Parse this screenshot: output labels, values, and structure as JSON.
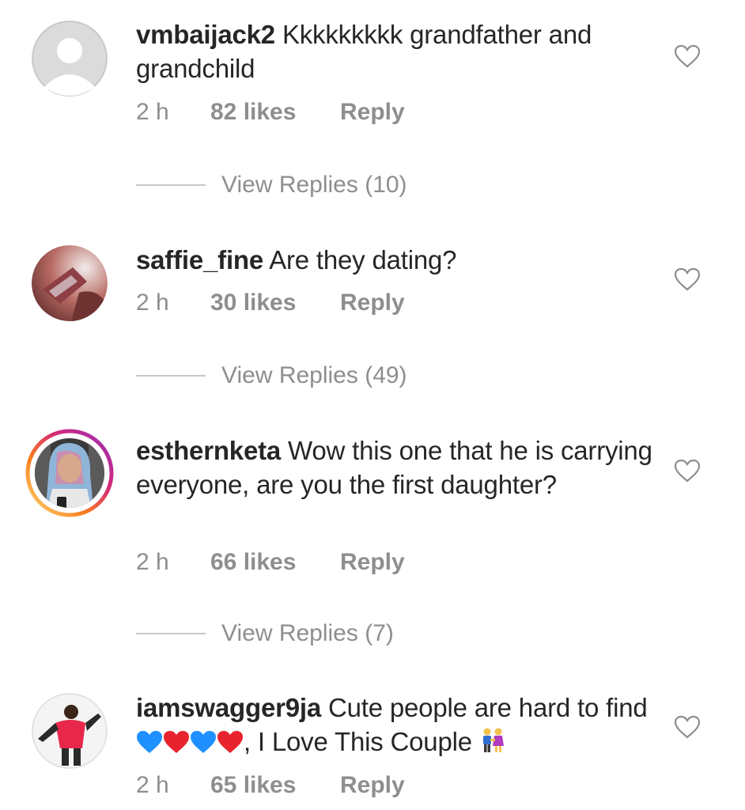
{
  "comments": [
    {
      "username": "vmbaijack2",
      "text": "Kkkkkkkkk grandfather  and grandchild",
      "time": "2 h",
      "likes": "82 likes",
      "reply": "Reply",
      "avatar": "default-avatar-icon",
      "replies_label": "View Replies (10)"
    },
    {
      "username": "saffie_fine",
      "text": "Are they dating?",
      "time": "2 h",
      "likes": "30 likes",
      "reply": "Reply",
      "avatar": "profile-photo",
      "replies_label": "View Replies (49)"
    },
    {
      "username": "esthernketa",
      "text": "Wow this one that he is carrying everyone, are you the first daughter?",
      "time": "2 h",
      "likes": "66 likes",
      "reply": "Reply",
      "avatar": "profile-photo-with-story-ring",
      "replies_label": "View Replies (7)"
    },
    {
      "username": "iamswagger9ja",
      "text_before_emoji": "Cute people are hard to find",
      "text_after_emoji": ", I Love This Couple",
      "emoji": [
        "blue-heart-icon",
        "red-heart-icon",
        "blue-heart-icon",
        "red-heart-icon"
      ],
      "trailing_emoji": "couple-holding-hands-icon",
      "time": "2 h",
      "likes": "65 likes",
      "reply": "Reply",
      "avatar": "profile-photo"
    }
  ],
  "colors": {
    "text": "#262626",
    "secondary": "#8e8e8e",
    "blue_heart": "#1e90ff",
    "red_heart": "#e8232e",
    "story_ring": "#d6249f"
  }
}
